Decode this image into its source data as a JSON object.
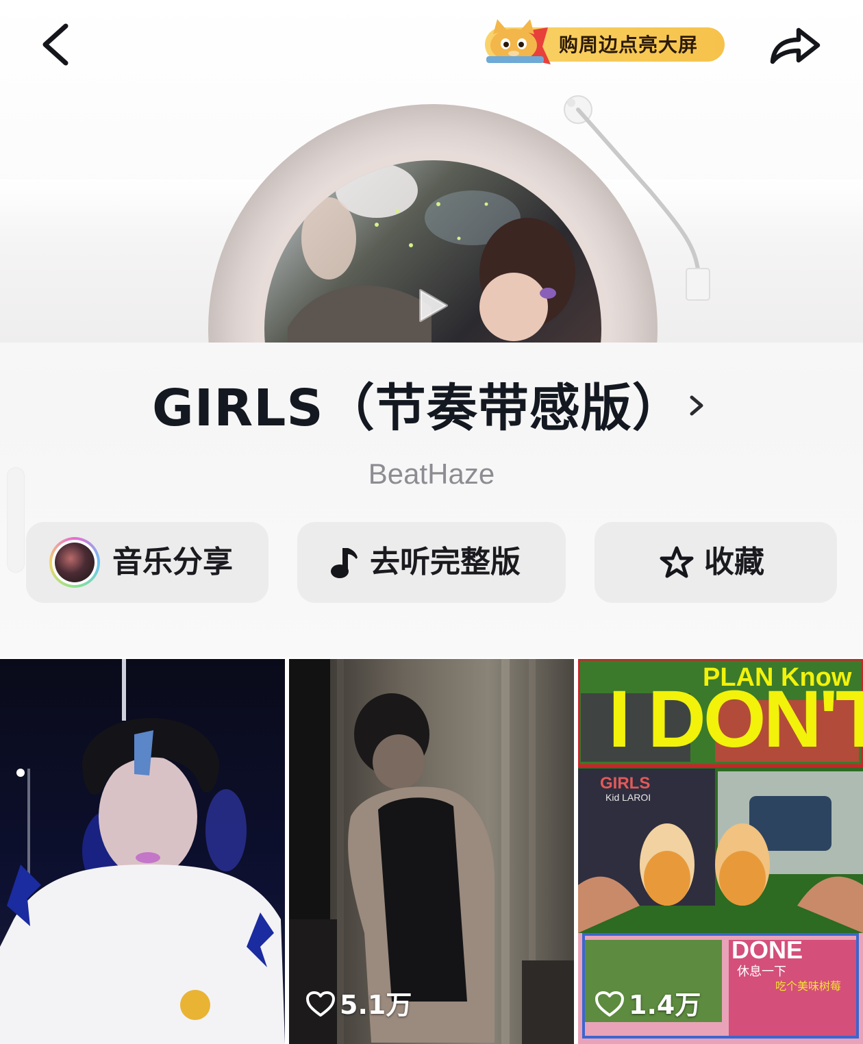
{
  "header": {
    "promo_text": "购周边点亮大屏",
    "back_icon": "chevron-left-icon",
    "share_icon": "share-arrow-icon"
  },
  "song": {
    "title": "GIRLS（节奏带感版）",
    "artist": "BeatHaze"
  },
  "actions": [
    {
      "label": "音乐分享",
      "icon": "avatar"
    },
    {
      "label": "去听完整版",
      "icon": "music-note-icon"
    },
    {
      "label": "收藏",
      "icon": "star-icon"
    }
  ],
  "videos": [
    {
      "likes": ""
    },
    {
      "likes": "5.1万"
    },
    {
      "likes": "1.4万",
      "poster": {
        "line1": "PLAN Know",
        "line2": "I DON'T",
        "tag": "GIRLS",
        "artist": "Kid LAROI",
        "done": "DONE",
        "caption1": "休息一下",
        "caption2": "吃个美味树莓"
      }
    }
  ],
  "colors": {
    "promo_bg": "#f7c955",
    "button_bg": "#ececec",
    "title": "#141820",
    "artist": "#8c8c92"
  }
}
